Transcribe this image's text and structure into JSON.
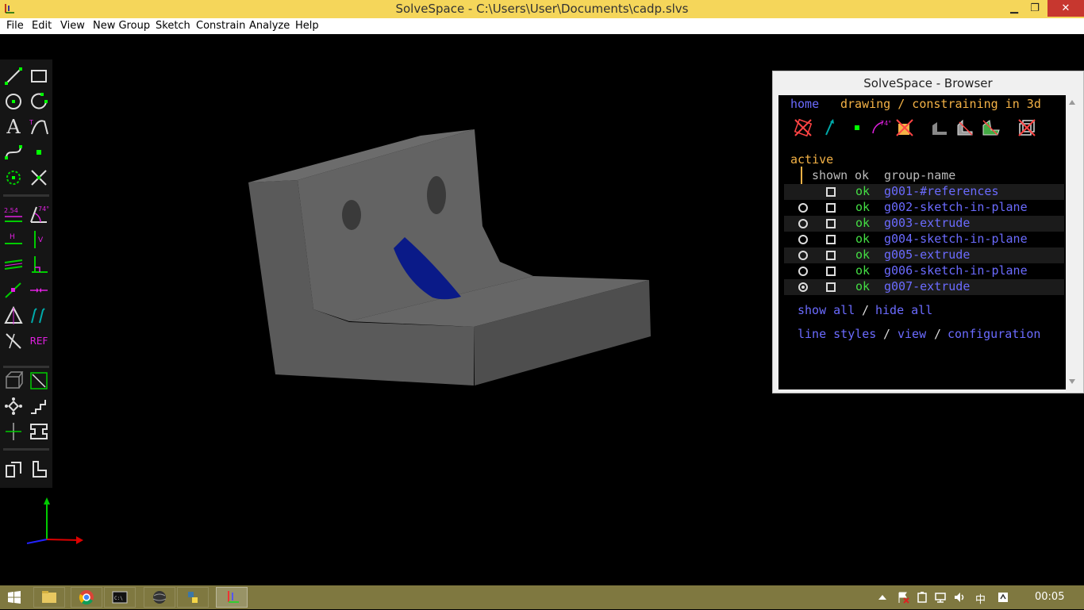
{
  "window": {
    "title": "SolveSpace - C:\\Users\\User\\Documents\\cadp.slvs",
    "min": "▁",
    "max": "❐",
    "close": "✕"
  },
  "menubar": [
    "File",
    "Edit",
    "View",
    "New Group",
    "Sketch",
    "Constrain",
    "Analyze",
    "Help"
  ],
  "toolbar": {
    "dim_label": "2.54",
    "angle_label": "74°",
    "h_label": "H",
    "v_label": "V",
    "ref_label": "REF",
    "text_label": "A"
  },
  "browser": {
    "title": "SolveSpace - Browser",
    "nav": {
      "home": "home",
      "mode": "drawing / constraining in 3d"
    },
    "icon_angle": "74°",
    "section": "active",
    "headers": {
      "shown": "shown",
      "ok": "ok",
      "group": "group-name"
    },
    "groups": [
      {
        "name": "g001-#references",
        "ok": "ok"
      },
      {
        "name": "g002-sketch-in-plane",
        "ok": "ok"
      },
      {
        "name": "g003-extrude",
        "ok": "ok"
      },
      {
        "name": "g004-sketch-in-plane",
        "ok": "ok"
      },
      {
        "name": "g005-extrude",
        "ok": "ok"
      },
      {
        "name": "g006-sketch-in-plane",
        "ok": "ok"
      },
      {
        "name": "g007-extrude",
        "ok": "ok"
      }
    ],
    "links": {
      "show_all": "show all",
      "sep1": "/",
      "hide_all": "hide all",
      "line_styles": "line styles",
      "sep2": "/",
      "view": "view",
      "sep3": "/",
      "configuration": "configuration"
    }
  },
  "taskbar": {
    "clock": "00:05",
    "ime": "中"
  },
  "colors": {
    "titlebar": "#f5d65a",
    "taskbar": "#7f7840",
    "link": "#6b6bff",
    "orange": "#f4b246",
    "green": "#44dd44",
    "model_face": "#5f5f5f",
    "selected_face": "#0a1a88"
  }
}
